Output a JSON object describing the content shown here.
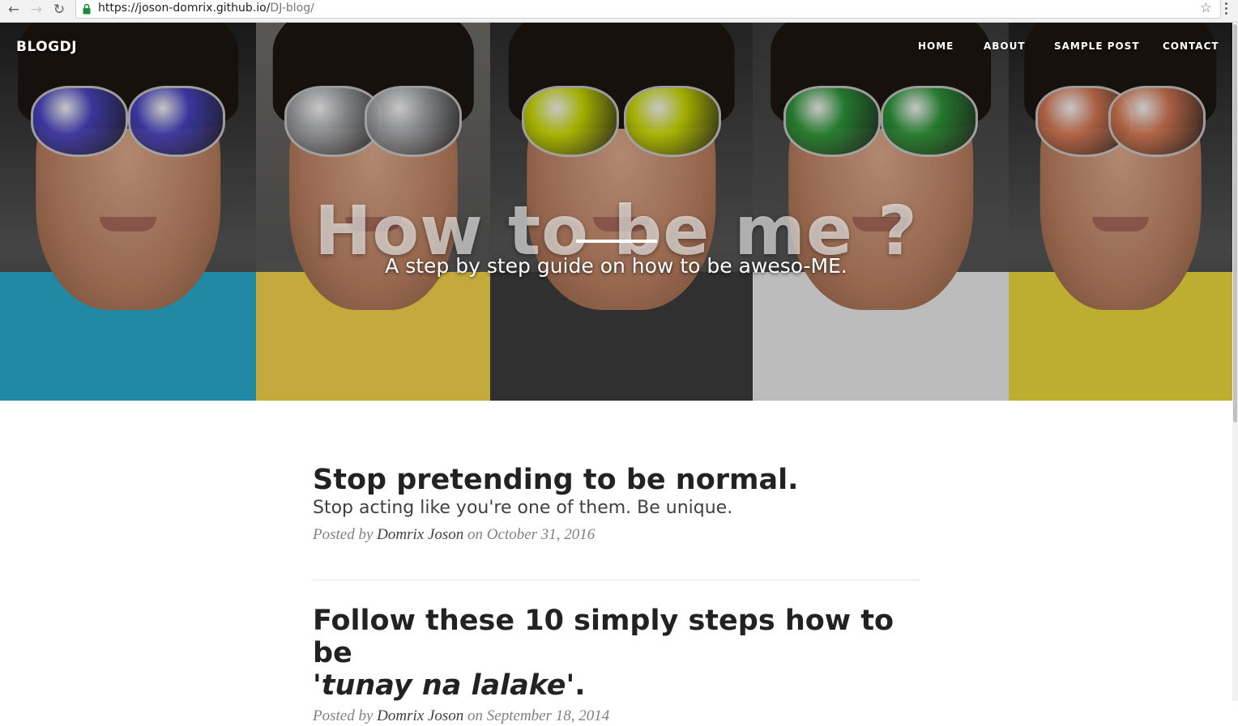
{
  "browser": {
    "back_icon": "back-arrow-icon",
    "forward_icon": "forward-arrow-icon",
    "reload_icon": "reload-icon",
    "url_host": "https://joson-domrix.github.io/",
    "url_path": "DJ-blog/",
    "bookmark_icon": "star-icon",
    "menu_icon": "kebab-menu-icon"
  },
  "site": {
    "brand": "BLOGDJ",
    "nav": [
      "HOME",
      "ABOUT",
      "SAMPLE POST",
      "CONTACT"
    ]
  },
  "hero": {
    "title": "How to be me ?",
    "subtitle": "A step by step guide on how to be aweso-ME.",
    "panels": [
      {
        "lens_color": "#4a45c8",
        "shirt_color": "#2aa8c8",
        "bg_color": "#1e1e1e"
      },
      {
        "lens_color": "#a7a9ad",
        "shirt_color": "#f0d04a",
        "bg_color": "#6d6a66"
      },
      {
        "lens_color": "#cfe000",
        "shirt_color": "#3b3b3b",
        "bg_color": "#2b2b2b"
      },
      {
        "lens_color": "#2d9a3a",
        "shirt_color": "#e6e6e6",
        "bg_color": "#3a3a3a"
      },
      {
        "lens_color": "#d97a55",
        "shirt_color": "#e7d33c",
        "bg_color": "#1f1f1f"
      }
    ]
  },
  "posts": [
    {
      "title": "Stop pretending to be normal.",
      "subtitle": "Stop acting like you're one of them. Be unique.",
      "posted_by": "Posted by",
      "author": "Domrix Joson",
      "on": "on",
      "date": "October 31, 2016"
    },
    {
      "title_main": "Follow these 10 simply steps how to be",
      "title_em": "'tunay na lalake'",
      "title_end": ".",
      "posted_by": "Posted by",
      "author": "Domrix Joson",
      "on": "on",
      "date": "September 18, 2014"
    }
  ]
}
